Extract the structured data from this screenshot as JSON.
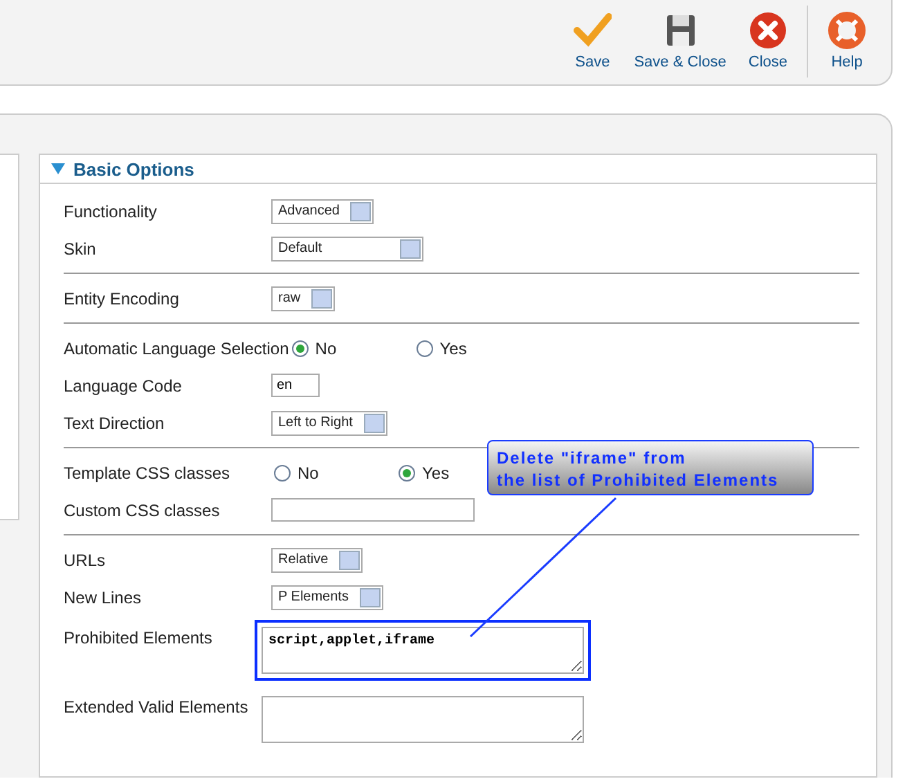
{
  "toolbar": [
    {
      "kind": "save",
      "label": "Save"
    },
    {
      "kind": "save-close",
      "label": "Save & Close"
    },
    {
      "kind": "close",
      "label": "Close"
    },
    {
      "kind": "help",
      "label": "Help"
    }
  ],
  "panel": {
    "title": "Basic Options",
    "expanded": true,
    "groups": [
      [
        {
          "kind": "select",
          "label": "Functionality",
          "value": "Advanced"
        },
        {
          "kind": "select",
          "label": "Skin",
          "value": "Default",
          "wide": true
        }
      ],
      [
        {
          "kind": "select",
          "label": "Entity Encoding",
          "value": "raw"
        }
      ],
      [
        {
          "kind": "radio",
          "label": "Automatic Language Selection",
          "options": [
            {
              "label": "No",
              "selected": true
            },
            {
              "label": "Yes",
              "selected": false
            }
          ]
        },
        {
          "kind": "text",
          "label": "Language Code",
          "value": "en",
          "short": true
        },
        {
          "kind": "select",
          "label": "Text Direction",
          "value": "Left to Right"
        }
      ],
      [
        {
          "kind": "radio",
          "label": "Template CSS classes",
          "options": [
            {
              "label": "No",
              "selected": false
            },
            {
              "label": "Yes",
              "selected": true
            }
          ]
        },
        {
          "kind": "text",
          "label": "Custom CSS classes"
        }
      ],
      [
        {
          "kind": "select",
          "label": "URLs",
          "value": "Relative"
        },
        {
          "kind": "select",
          "label": "New Lines",
          "value": "P Elements"
        },
        {
          "kind": "textarea",
          "label": "Prohibited Elements",
          "value": "script,applet,iframe",
          "highlighted": true
        },
        {
          "kind": "textarea",
          "label": "Extended Valid Elements",
          "highlighted": false
        }
      ]
    ]
  },
  "callout": {
    "lines": [
      "Delete \"iframe\" from",
      "the list of Prohibited Elements"
    ]
  }
}
